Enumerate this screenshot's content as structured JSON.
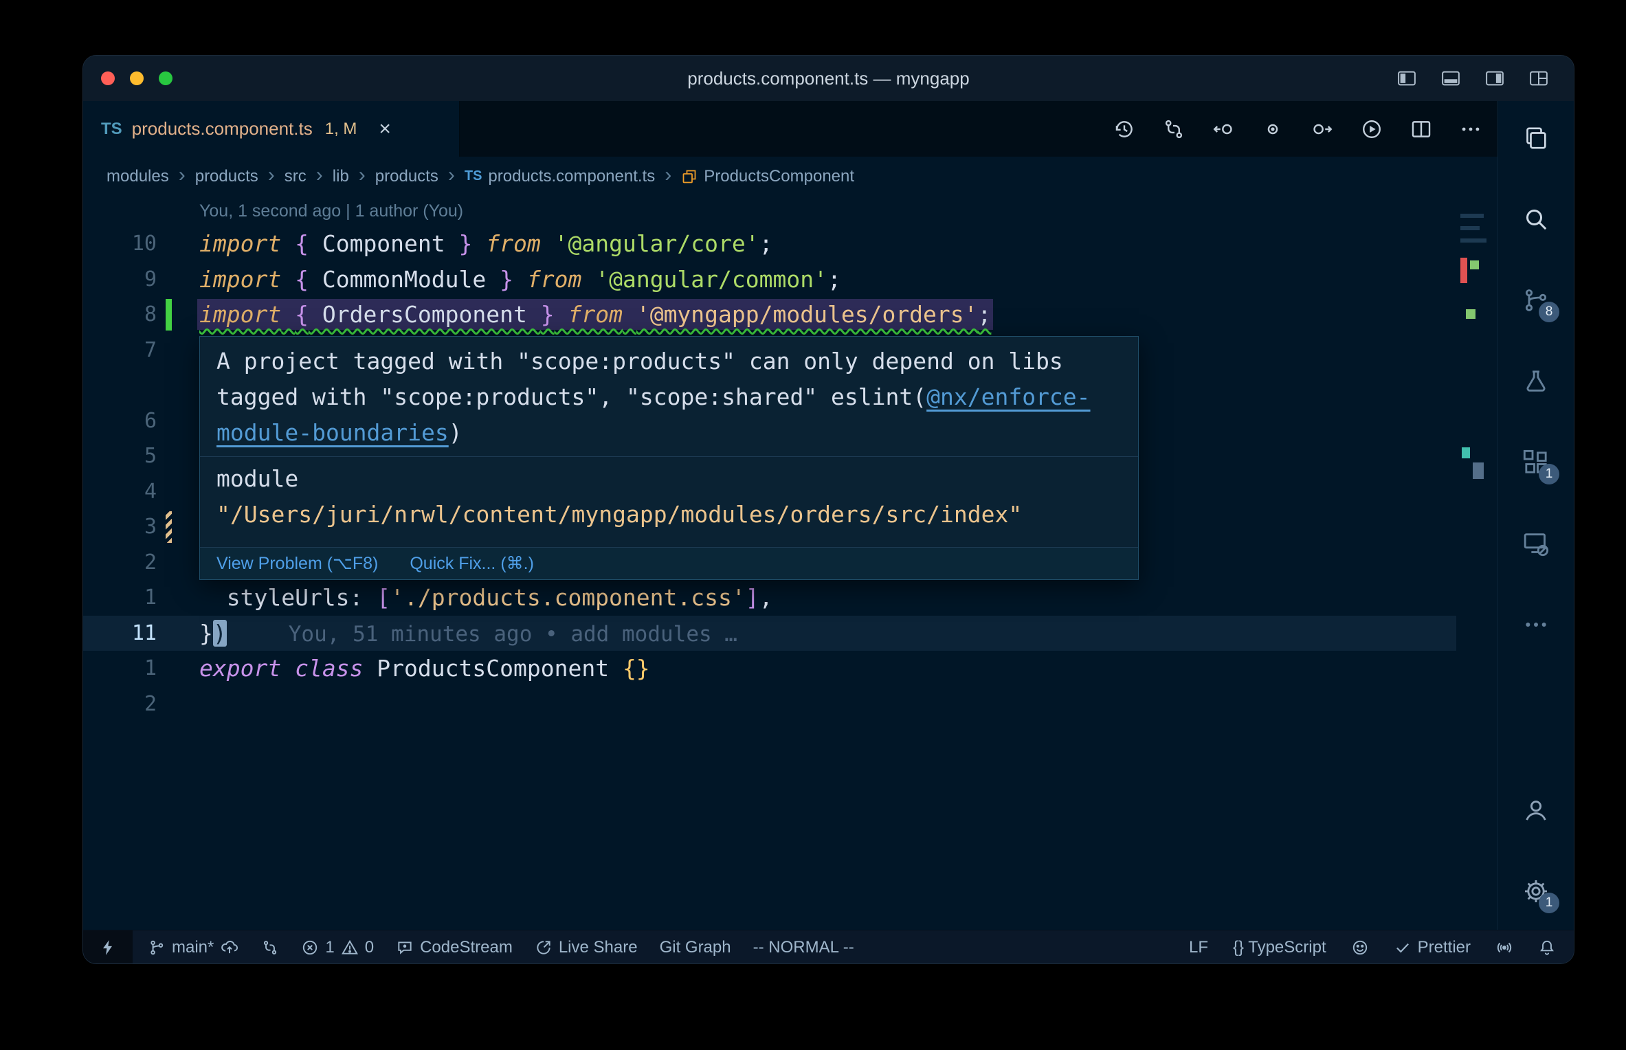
{
  "window": {
    "title": "products.component.ts — myngapp"
  },
  "tab": {
    "lang": "TS",
    "label": "products.component.ts",
    "dirty": "1, M",
    "close": "×"
  },
  "breadcrumbs": {
    "separator": "›",
    "items": [
      {
        "label": "modules"
      },
      {
        "label": "products"
      },
      {
        "label": "src"
      },
      {
        "label": "lib"
      },
      {
        "label": "products"
      },
      {
        "label": "products.component.ts",
        "badge": "TS"
      },
      {
        "label": "ProductsComponent",
        "icon": "class"
      }
    ]
  },
  "editor": {
    "codelens": "You, 1 second ago | 1 author (You)",
    "rows": [
      {
        "num": "10",
        "tokens": [
          [
            "kw",
            "import"
          ],
          [
            "pln",
            " "
          ],
          [
            "pun",
            "{"
          ],
          [
            "pln",
            " Component "
          ],
          [
            "pun",
            "}"
          ],
          [
            "kw",
            " from"
          ],
          [
            "pln",
            " "
          ],
          [
            "strg",
            "'@angular/core'"
          ],
          [
            "pln",
            ";"
          ]
        ]
      },
      {
        "num": "9",
        "tokens": [
          [
            "kw",
            "import"
          ],
          [
            "pln",
            " "
          ],
          [
            "pun",
            "{"
          ],
          [
            "pln",
            " CommonModule "
          ],
          [
            "pun",
            "}"
          ],
          [
            "kw",
            " from"
          ],
          [
            "pln",
            " "
          ],
          [
            "strg",
            "'@angular/common'"
          ],
          [
            "pln",
            ";"
          ]
        ]
      },
      {
        "num": "8",
        "highlight": true,
        "squiggle": true,
        "gutter": "added",
        "tokens": [
          [
            "kw",
            "import"
          ],
          [
            "pln",
            " "
          ],
          [
            "pun",
            "{"
          ],
          [
            "pln",
            " OrdersComponent "
          ],
          [
            "pun",
            "}"
          ],
          [
            "kw",
            " from"
          ],
          [
            "pln",
            " "
          ],
          [
            "stry",
            "'@myngapp/modules/orders'"
          ],
          [
            "pln",
            ";"
          ]
        ]
      },
      {
        "num": "7",
        "tokens": []
      },
      {
        "num": "",
        "tokens": []
      },
      {
        "num": "6",
        "tokens": []
      },
      {
        "num": "5",
        "tokens": []
      },
      {
        "num": "4",
        "tokens": []
      },
      {
        "num": "3",
        "gutter": "modified",
        "tokens": []
      },
      {
        "num": "2",
        "tokens": []
      },
      {
        "num": "1",
        "tokens": [
          [
            "pln",
            "  styleUrls"
          ],
          [
            "pln",
            ": "
          ],
          [
            "pun",
            "["
          ],
          [
            "stry",
            "'./products.component.css'"
          ],
          [
            "pun",
            "]"
          ],
          [
            "pln",
            ","
          ]
        ]
      },
      {
        "num": "11",
        "current": true,
        "blame": "You, 51 minutes ago • add modules …",
        "tokens": [
          [
            "pln",
            "}"
          ],
          [
            "cur",
            ")"
          ]
        ]
      },
      {
        "num": "1",
        "tokens": [
          [
            "kwm",
            "export"
          ],
          [
            "pln",
            " "
          ],
          [
            "kwm",
            "class"
          ],
          [
            "pln",
            " ProductsComponent "
          ],
          [
            "gold",
            "{}"
          ]
        ]
      },
      {
        "num": "2",
        "tokens": []
      }
    ]
  },
  "hover": {
    "message_1": "A project tagged with \"scope:products\" can only depend on libs tagged with \"scope:products\", \"scope:shared\" eslint(",
    "link": "@nx/enforce-module-boundaries",
    "message_2": ")",
    "module_label": "module",
    "module_path": "\"/Users/juri/nrwl/content/myngapp/modules/orders/src/index\"",
    "actions": {
      "view_problem": "View Problem (⌥F8)",
      "quick_fix": "Quick Fix... (⌘.)"
    }
  },
  "activity_bar": {
    "scm_badge": "8",
    "extensions_badge": "1",
    "settings_badge": "1"
  },
  "statusbar": {
    "branch": "main*",
    "errors": "1",
    "warnings": "0",
    "codestream": "CodeStream",
    "live_share": "Live Share",
    "git_graph": "Git Graph",
    "vim_mode": "-- NORMAL --",
    "eol": "LF",
    "language": "{} TypeScript",
    "prettier": "Prettier"
  },
  "colors": {
    "editor_bg": "#011627",
    "tab_modified": "#e2c08d",
    "error_squiggle": "#3ecb3e",
    "added_gutter": "#43d143",
    "hover_link": "#539bd5",
    "keyword": "#e0af68",
    "string_green": "#addb67",
    "string_peach": "#ecc48d"
  }
}
